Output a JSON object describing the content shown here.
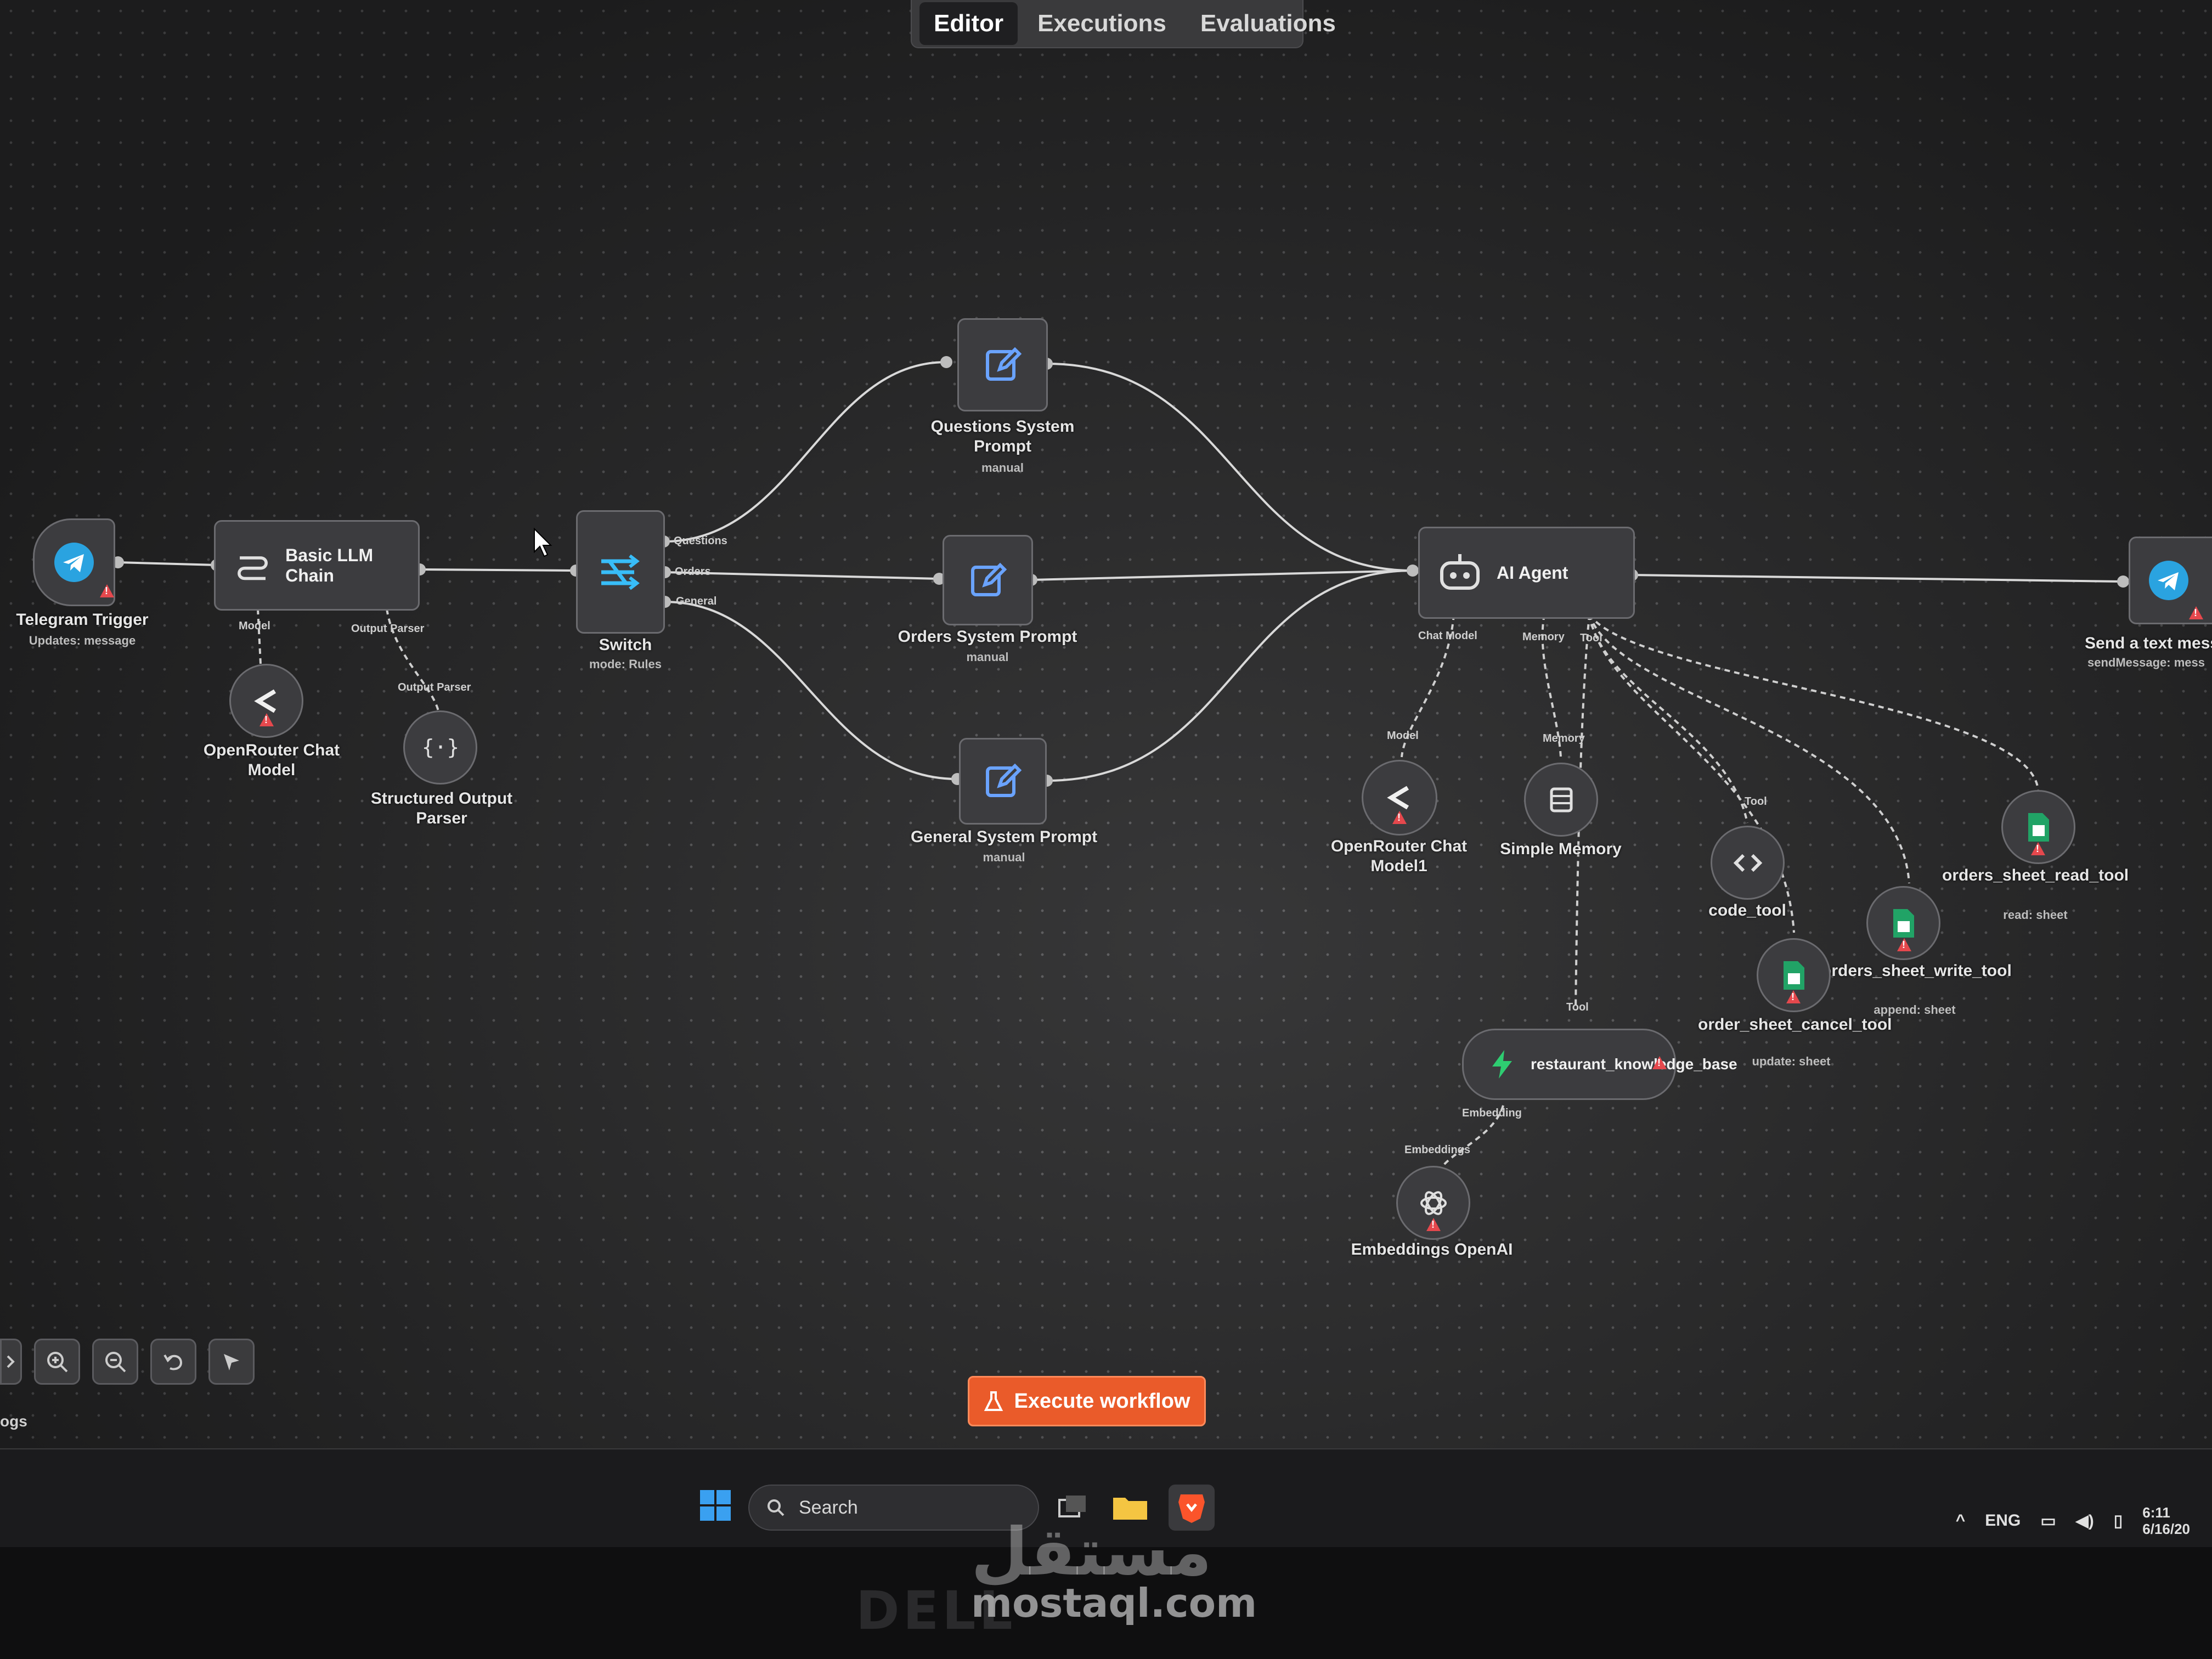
{
  "tabs": [
    {
      "label": "Editor",
      "active": true
    },
    {
      "label": "Executions",
      "active": false
    },
    {
      "label": "Evaluations",
      "active": false
    }
  ],
  "nodes": {
    "telegram_trigger": {
      "name": "Telegram Trigger",
      "sub": "Updates: message"
    },
    "basic_llm_chain": {
      "name": "Basic LLM Chain",
      "port_model": "Model",
      "port_output_parser": "Output Parser"
    },
    "openrouter_chat_model": {
      "name": "OpenRouter Chat Model",
      "port": "Model"
    },
    "structured_output_parser": {
      "name": "Structured Output Parser",
      "port": "Output Parser"
    },
    "switch": {
      "name": "Switch",
      "sub": "mode: Rules",
      "outputs": [
        "Questions",
        "Orders",
        "General"
      ]
    },
    "questions_prompt": {
      "name": "Questions System Prompt",
      "sub": "manual"
    },
    "orders_prompt": {
      "name": "Orders System Prompt",
      "sub": "manual"
    },
    "general_prompt": {
      "name": "General System Prompt",
      "sub": "manual"
    },
    "ai_agent": {
      "name": "AI Agent",
      "port_chat_model": "Chat Model",
      "port_memory": "Memory",
      "port_tool": "Tool"
    },
    "openrouter_chat_model1": {
      "name": "OpenRouter Chat Model1",
      "port": "Model"
    },
    "simple_memory": {
      "name": "Simple Memory",
      "port": "Memory"
    },
    "code_tool": {
      "name": "code_tool",
      "port": "Tool"
    },
    "orders_sheet_read_tool": {
      "name": "orders_sheet_read_tool",
      "sub": "read: sheet"
    },
    "orders_sheet_write_tool": {
      "name": "orders_sheet_write_tool",
      "sub": "append: sheet"
    },
    "order_sheet_cancel_tool": {
      "name": "order_sheet_cancel_tool",
      "sub": "update: sheet"
    },
    "restaurant_knowledge_base": {
      "name": "restaurant_knowledge_base",
      "port_tool": "Tool",
      "port_embedding": "Embedding"
    },
    "embeddings_openai": {
      "name": "Embeddings OpenAI",
      "port": "Embeddings"
    },
    "send_text": {
      "name": "Send a text mess",
      "sub": "sendMessage: mess"
    }
  },
  "execute_button": {
    "label": "Execute workflow"
  },
  "logs_tab": {
    "label": "ogs"
  },
  "taskbar": {
    "search_placeholder": "Search",
    "lang": "ENG",
    "time": "6:11",
    "date": "6/16/20"
  },
  "watermark": {
    "arabic": "مستقل",
    "site": "mostaql.com"
  },
  "monitor_brand": "DELL",
  "colors": {
    "accent": "#ea5b2a",
    "canvas": "#2b2b2c",
    "node": "#3c3c3f",
    "warning": "#e5484d",
    "telegram": "#2aa3e0",
    "sheets": "#21a366"
  }
}
